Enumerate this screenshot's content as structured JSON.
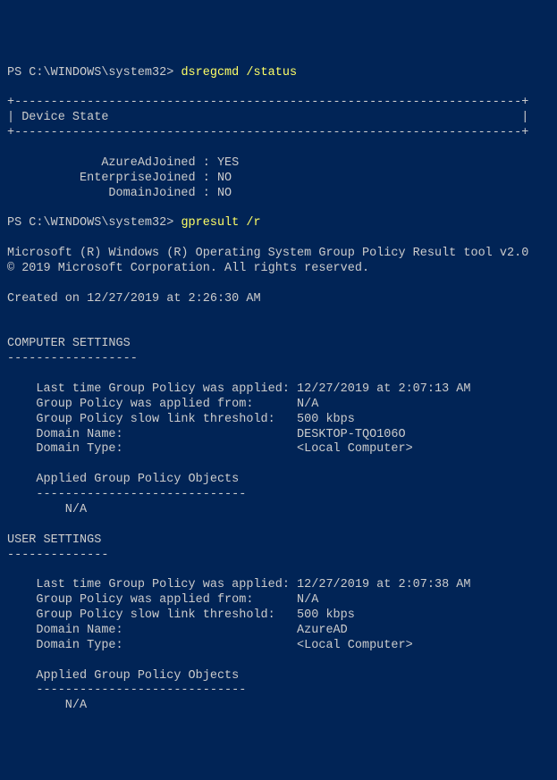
{
  "cmd1": {
    "prompt": "PS C:\\WINDOWS\\system32> ",
    "command": "dsregcmd /status",
    "section_rule": "+----------------------------------------------------------------------+",
    "section_title": "| Device State                                                         |",
    "section_rule2": "+----------------------------------------------------------------------+",
    "l1": "             AzureAdJoined : YES",
    "l2": "          EnterpriseJoined : NO",
    "l3": "              DomainJoined : NO"
  },
  "cmd2": {
    "prompt": "PS C:\\WINDOWS\\system32> ",
    "command": "gpresult /r",
    "banner1": "Microsoft (R) Windows (R) Operating System Group Policy Result tool v2.0",
    "banner2": "© 2019 Microsoft Corporation. All rights reserved.",
    "created": "Created on ‎12/‎27/‎2019 at 2:26:30 AM"
  },
  "comp": {
    "title": "COMPUTER SETTINGS",
    "rule": "------------------",
    "l1": "    Last time Group Policy was applied: 12/27/2019 at 2:07:13 AM",
    "l2": "    Group Policy was applied from:      N/A",
    "l3": "    Group Policy slow link threshold:   500 kbps",
    "l4": "    Domain Name:                        DESKTOP-TQO106O",
    "l5": "    Domain Type:                        <Local Computer>",
    "gpoT": "    Applied Group Policy Objects",
    "gpoR": "    -----------------------------",
    "gpo1": "        N/A"
  },
  "user": {
    "title": "USER SETTINGS",
    "rule": "--------------",
    "l1": "    Last time Group Policy was applied: 12/27/2019 at 2:07:38 AM",
    "l2": "    Group Policy was applied from:      N/A",
    "l3": "    Group Policy slow link threshold:   500 kbps",
    "l4": "    Domain Name:                        AzureAD",
    "l5": "    Domain Type:                        <Local Computer>",
    "gpoT": "    Applied Group Policy Objects",
    "gpoR": "    -----------------------------",
    "gpo1": "        N/A"
  }
}
